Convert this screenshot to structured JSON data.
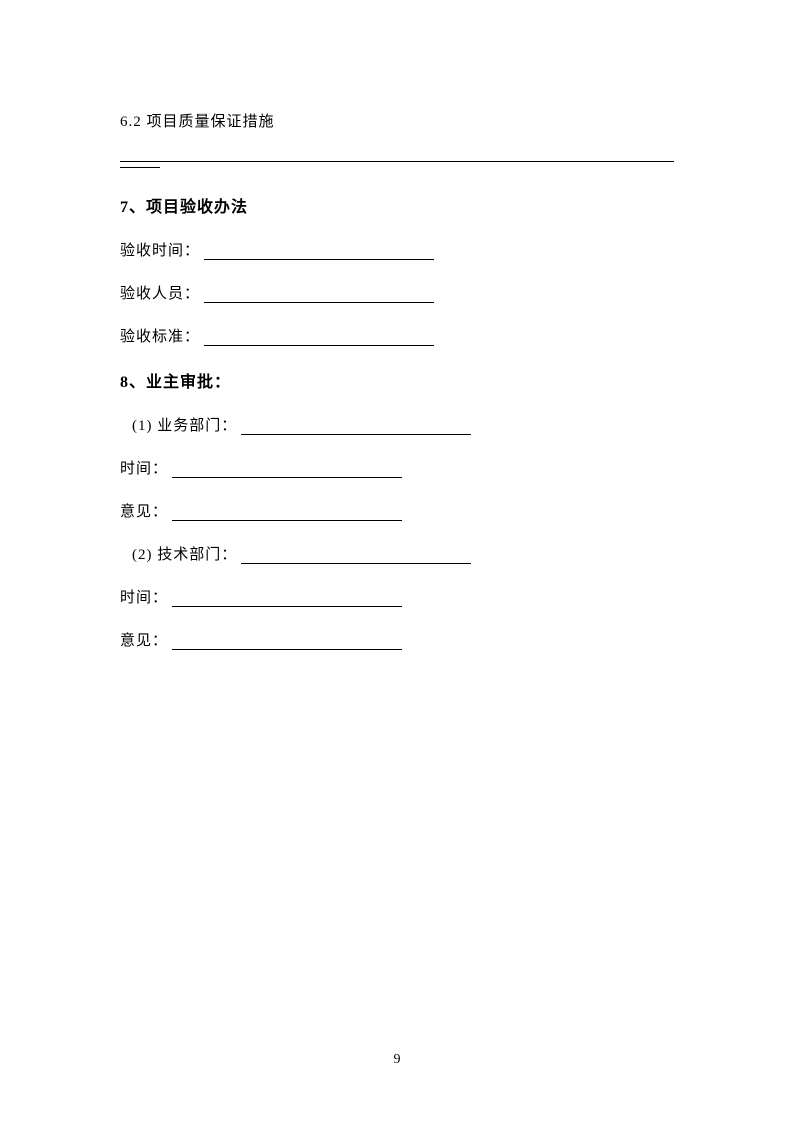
{
  "sections": {
    "s6_2": "6.2 项目质量保证措施",
    "s7_heading": "7、项目验收办法",
    "s7_fields": {
      "time": "验收时间：",
      "person": "验收人员：",
      "standard": "验收标准："
    },
    "s8_heading": "8、业主审批：",
    "s8_sub1": "(1) 业务部门：",
    "s8_sub2": "(2) 技术部门：",
    "s8_common": {
      "time": "时间：",
      "opinion": "意见："
    }
  },
  "page_number": "9"
}
